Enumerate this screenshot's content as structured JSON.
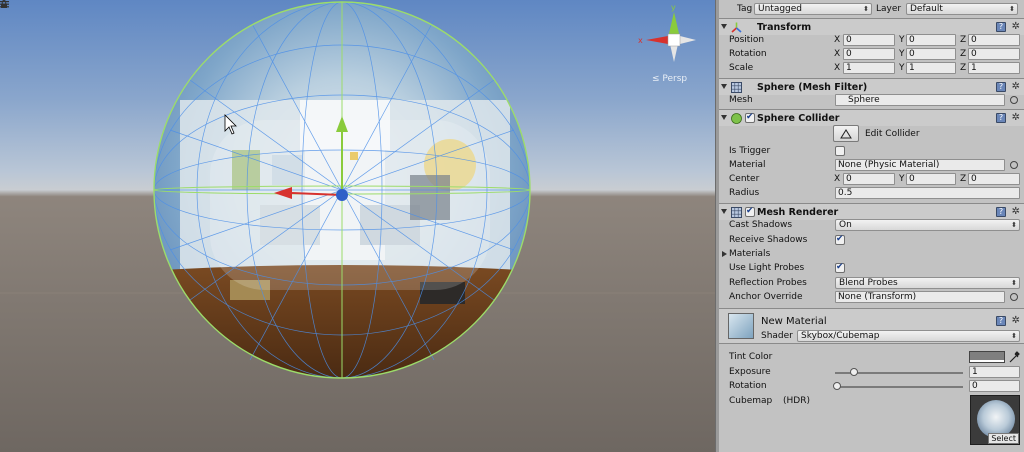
{
  "scene": {
    "persp_label": "≤ Persp",
    "gizmo_axes": {
      "x": "#d7322e",
      "y": "#8acb3c",
      "z": "#3a6fd8"
    }
  },
  "header": {
    "tag_label": "Tag",
    "tag_value": "Untagged",
    "layer_label": "Layer",
    "layer_value": "Default"
  },
  "transform": {
    "title": "Transform",
    "position_label": "Position",
    "rotation_label": "Rotation",
    "scale_label": "Scale",
    "axis_x": "X",
    "axis_y": "Y",
    "axis_z": "Z",
    "position": [
      "0",
      "0",
      "0"
    ],
    "rotation": [
      "0",
      "0",
      "0"
    ],
    "scale": [
      "1",
      "1",
      "1"
    ]
  },
  "mesh_filter": {
    "title": "Sphere (Mesh Filter)",
    "mesh_label": "Mesh",
    "mesh_value": "Sphere"
  },
  "sphere_collider": {
    "title": "Sphere Collider",
    "edit_collider_label": "Edit Collider",
    "is_trigger_label": "Is Trigger",
    "material_label": "Material",
    "material_value": "None (Physic Material)",
    "center_label": "Center",
    "center": [
      "0",
      "0",
      "0"
    ],
    "radius_label": "Radius",
    "radius_value": "0.5"
  },
  "mesh_renderer": {
    "title": "Mesh Renderer",
    "cast_shadows_label": "Cast Shadows",
    "cast_shadows_value": "On",
    "receive_shadows_label": "Receive Shadows",
    "materials_label": "Materials",
    "use_light_probes_label": "Use Light Probes",
    "reflection_probes_label": "Reflection Probes",
    "reflection_probes_value": "Blend Probes",
    "anchor_override_label": "Anchor Override",
    "anchor_override_value": "None (Transform)"
  },
  "material": {
    "title": "New Material",
    "shader_label": "Shader",
    "shader_value": "Skybox/Cubemap",
    "tint_color_label": "Tint Color",
    "exposure_label": "Exposure",
    "exposure_value": "1",
    "exposure_slider": 0.15,
    "rotation_label": "Rotation",
    "rotation_value": "0",
    "rotation_slider": 0.0,
    "cubemap_label": "Cubemap",
    "cubemap_hdr": "(HDR)",
    "select_label": "Select"
  }
}
